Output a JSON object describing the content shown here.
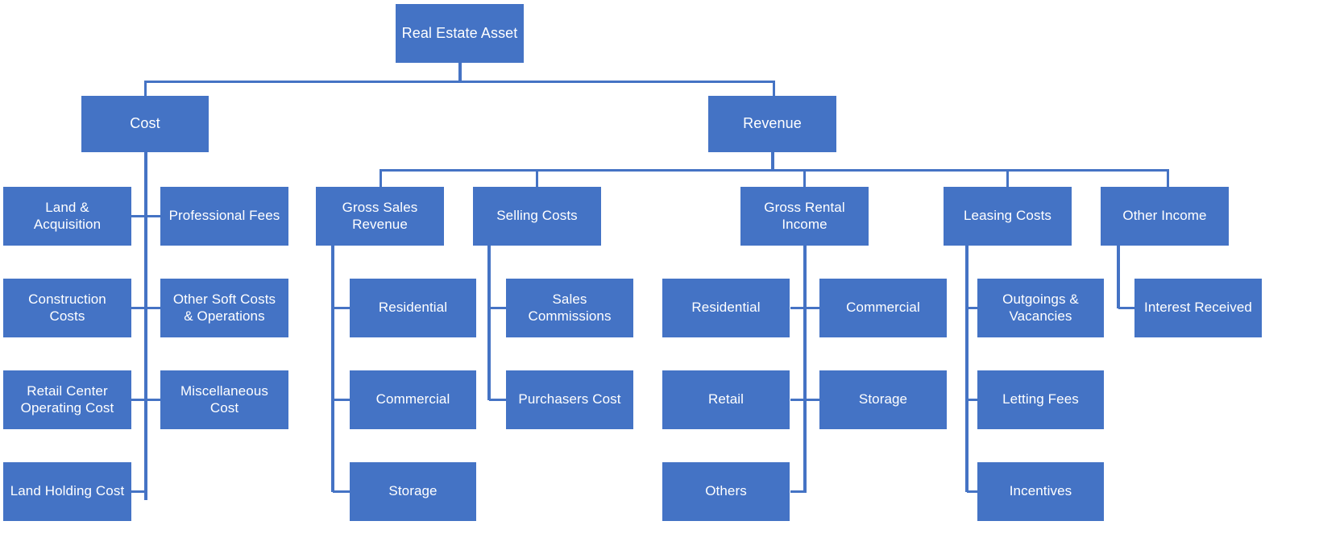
{
  "diagram": {
    "title": "Real Estate Asset",
    "type": "organizational-breakdown-tree",
    "theme": {
      "node_fill": "#4473C5",
      "node_text": "#ffffff",
      "connector": "#4573C4",
      "background": "#ffffff"
    },
    "nodes": {
      "root": "Real Estate Asset",
      "cost": "Cost",
      "revenue": "Revenue",
      "cost_children": [
        "Land & Acquisition",
        "Professional Fees",
        "Construction Costs",
        "Other Soft Costs & Operations",
        "Retail Center Operating Cost",
        "Miscellaneous Cost",
        "Land Holding Cost"
      ],
      "revenue_children": [
        "Gross Sales Revenue",
        "Selling Costs",
        "Gross Rental Income",
        "Leasing Costs",
        "Other Income"
      ],
      "gross_sales_revenue_children": [
        "Residential",
        "Commercial",
        "Storage"
      ],
      "selling_costs_children": [
        "Sales Commissions",
        "Purchasers Cost"
      ],
      "gross_rental_income_children": [
        "Residential",
        "Commercial",
        "Retail",
        "Storage",
        "Others"
      ],
      "leasing_costs_children": [
        "Outgoings & Vacancies",
        "Letting Fees",
        "Incentives"
      ],
      "other_income_children": [
        "Interest Received"
      ]
    },
    "labels": {
      "root": "Real Estate Asset",
      "cost": "Cost",
      "revenue": "Revenue",
      "land_acquisition": "Land &\nAcquisition",
      "professional_fees": "Professional Fees",
      "construction_costs": "Construction\nCosts",
      "other_soft_costs": "Other Soft Costs\n& Operations",
      "retail_center_operating_cost": "Retail Center\nOperating Cost",
      "miscellaneous_cost": "Miscellaneous\nCost",
      "land_holding_cost": "Land Holding Cost",
      "gross_sales_revenue": "Gross Sales\nRevenue",
      "selling_costs": "Selling Costs",
      "gross_rental_income": "Gross Rental\nIncome",
      "leasing_costs": "Leasing Costs",
      "other_income": "Other Income",
      "gsr_residential": "Residential",
      "gsr_commercial": "Commercial",
      "gsr_storage": "Storage",
      "sc_sales_commissions": "Sales\nCommissions",
      "sc_purchasers_cost": "Purchasers Cost",
      "gri_residential": "Residential",
      "gri_commercial": "Commercial",
      "gri_retail": "Retail",
      "gri_storage": "Storage",
      "gri_others": "Others",
      "lc_outgoings_vacancies": "Outgoings &\nVacancies",
      "lc_letting_fees": "Letting Fees",
      "lc_incentives": "Incentives",
      "oi_interest_received": "Interest Received"
    }
  }
}
